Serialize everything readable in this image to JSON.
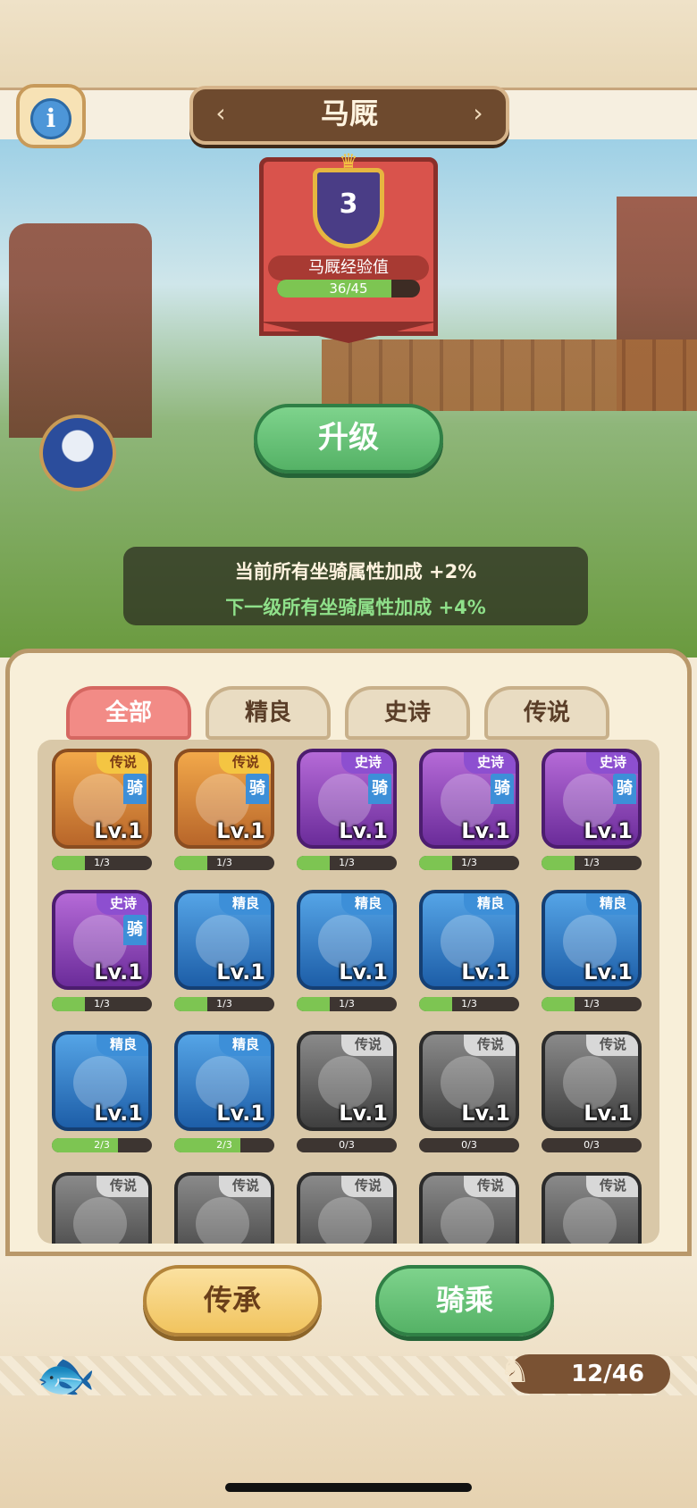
{
  "header": {
    "title": "马厩",
    "prev_arrow": "‹",
    "next_arrow": "›",
    "info_icon": "i"
  },
  "stable": {
    "level": "3",
    "exp_label": "马厩经验值",
    "exp_text": "36/45",
    "exp_progress": 0.8,
    "upgrade_label": "升级",
    "bonus_current": "当前所有坐骑属性加成  +2%",
    "bonus_next": "下一级所有坐骑属性加成  +4%"
  },
  "tabs": [
    "全部",
    "精良",
    "史诗",
    "传说"
  ],
  "active_tab": 0,
  "mounts": [
    {
      "rarity": "legend",
      "badge": "传说",
      "ride": "骑",
      "level": "Lv.1",
      "progress": "1/3",
      "fill": 0.33
    },
    {
      "rarity": "legend",
      "badge": "传说",
      "ride": "骑",
      "level": "Lv.1",
      "progress": "1/3",
      "fill": 0.33
    },
    {
      "rarity": "epic",
      "badge": "史诗",
      "ride": "骑",
      "level": "Lv.1",
      "progress": "1/3",
      "fill": 0.33
    },
    {
      "rarity": "epic",
      "badge": "史诗",
      "ride": "骑",
      "level": "Lv.1",
      "progress": "1/3",
      "fill": 0.33
    },
    {
      "rarity": "epic",
      "badge": "史诗",
      "ride": "骑",
      "level": "Lv.1",
      "progress": "1/3",
      "fill": 0.33
    },
    {
      "rarity": "epic",
      "badge": "史诗",
      "ride": "骑",
      "level": "Lv.1",
      "progress": "1/3",
      "fill": 0.33
    },
    {
      "rarity": "fine",
      "badge": "精良",
      "ride": "",
      "level": "Lv.1",
      "progress": "1/3",
      "fill": 0.33
    },
    {
      "rarity": "fine",
      "badge": "精良",
      "ride": "",
      "level": "Lv.1",
      "progress": "1/3",
      "fill": 0.33
    },
    {
      "rarity": "fine",
      "badge": "精良",
      "ride": "",
      "level": "Lv.1",
      "progress": "1/3",
      "fill": 0.33
    },
    {
      "rarity": "fine",
      "badge": "精良",
      "ride": "",
      "level": "Lv.1",
      "progress": "1/3",
      "fill": 0.33
    },
    {
      "rarity": "fine",
      "badge": "精良",
      "ride": "",
      "level": "Lv.1",
      "progress": "2/3",
      "fill": 0.66
    },
    {
      "rarity": "fine",
      "badge": "精良",
      "ride": "",
      "level": "Lv.1",
      "progress": "2/3",
      "fill": 0.66
    },
    {
      "rarity": "locked",
      "badge": "传说",
      "ride": "",
      "level": "Lv.1",
      "progress": "0/3",
      "fill": 0
    },
    {
      "rarity": "locked",
      "badge": "传说",
      "ride": "",
      "level": "Lv.1",
      "progress": "0/3",
      "fill": 0
    },
    {
      "rarity": "locked",
      "badge": "传说",
      "ride": "",
      "level": "Lv.1",
      "progress": "0/3",
      "fill": 0
    },
    {
      "rarity": "locked",
      "badge": "传说",
      "ride": "",
      "level": "",
      "progress": "",
      "fill": 0
    },
    {
      "rarity": "locked",
      "badge": "传说",
      "ride": "",
      "level": "",
      "progress": "",
      "fill": 0
    },
    {
      "rarity": "locked",
      "badge": "传说",
      "ride": "",
      "level": "",
      "progress": "",
      "fill": 0
    },
    {
      "rarity": "locked",
      "badge": "传说",
      "ride": "",
      "level": "",
      "progress": "",
      "fill": 0
    },
    {
      "rarity": "locked",
      "badge": "传说",
      "ride": "",
      "level": "",
      "progress": "",
      "fill": 0
    }
  ],
  "actions": {
    "inherit_label": "传承",
    "ride_label": "骑乘"
  },
  "collection": {
    "count": "12/46",
    "icon": "horse-icon"
  }
}
